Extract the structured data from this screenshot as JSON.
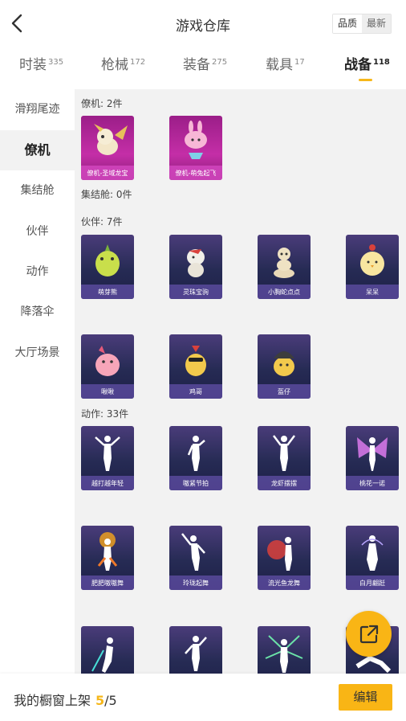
{
  "header": {
    "title": "游戏仓库",
    "sort_options": [
      "品质",
      "最新"
    ],
    "sort_active": "品质"
  },
  "tabs": [
    {
      "label": "时装",
      "count": "335"
    },
    {
      "label": "枪械",
      "count": "172"
    },
    {
      "label": "装备",
      "count": "275"
    },
    {
      "label": "载具",
      "count": "17"
    },
    {
      "label": "战备",
      "count": "118"
    }
  ],
  "active_tab": "战备",
  "sidebar": {
    "items": [
      "滑翔尾迹",
      "僚机",
      "集结舱",
      "伙伴",
      "动作",
      "降落伞",
      "大厅场景"
    ],
    "active": "僚机"
  },
  "sections": {
    "wingman": {
      "title": "僚机: 2件",
      "items": [
        "僚机-圣域龙宝",
        "僚机-萌兔起飞"
      ]
    },
    "pod": {
      "title": "集结舱: 0件"
    },
    "partner": {
      "title": "伙伴: 7件",
      "items": [
        "萌芽熊",
        "灵珠宝驹",
        "小胸蛇点点",
        "呆呆",
        "啾啾",
        "鸡哥",
        "盔仔"
      ]
    },
    "action": {
      "title": "动作: 33件",
      "items": [
        "越打越年轻",
        "嗷紧节拍",
        "龙虾摆摆",
        "桃花一诺",
        "肥肥嗷嗷舞",
        "玲珑起舞",
        "流光鱼龙舞",
        "白月翩跹",
        "",
        "",
        "",
        ""
      ]
    }
  },
  "bottom_bar": {
    "label": "我的橱窗上架",
    "current": "5",
    "separator": "/",
    "max": "5",
    "edit_label": "编辑"
  },
  "colors": {
    "accent": "#f9b515",
    "card_purple": "#2a2c58",
    "card_pink": "#c42ea7"
  }
}
